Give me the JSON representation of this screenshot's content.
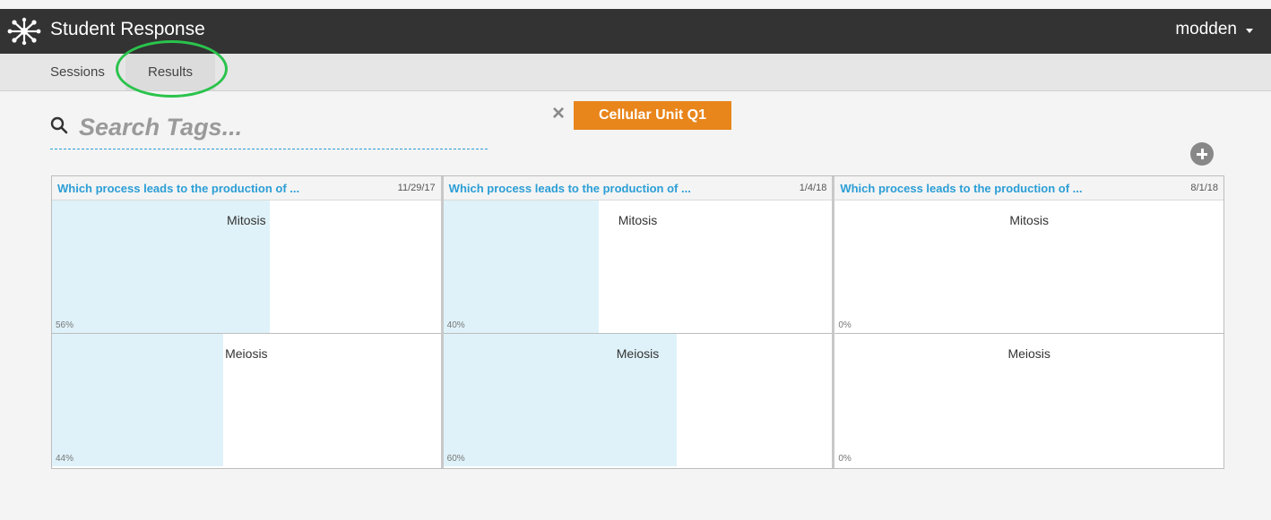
{
  "app": {
    "title": "Student Response",
    "user": "modden"
  },
  "nav": {
    "tabs": [
      {
        "label": "Sessions"
      },
      {
        "label": "Results",
        "active": true
      }
    ]
  },
  "search": {
    "placeholder": "Search Tags...",
    "value": ""
  },
  "active_tag": {
    "remove_glyph": "×",
    "label": "Cellular Unit Q1",
    "color": "#e8851b"
  },
  "colors": {
    "topbar": "#333333",
    "accent_link": "#2b9ed6",
    "bar_fill": "#dff2f9",
    "highlight_ring": "#2ac34c"
  },
  "results": [
    {
      "question": "Which process leads to the production of ...",
      "date": "11/29/17",
      "answers": [
        {
          "label": "Mitosis",
          "percent": 56,
          "percent_text": "56%"
        },
        {
          "label": "Meiosis",
          "percent": 44,
          "percent_text": "44%"
        }
      ]
    },
    {
      "question": "Which process leads to the production of ...",
      "date": "1/4/18",
      "answers": [
        {
          "label": "Mitosis",
          "percent": 40,
          "percent_text": "40%"
        },
        {
          "label": "Meiosis",
          "percent": 60,
          "percent_text": "60%"
        }
      ]
    },
    {
      "question": "Which process leads to the production of ...",
      "date": "8/1/18",
      "answers": [
        {
          "label": "Mitosis",
          "percent": 0,
          "percent_text": "0%"
        },
        {
          "label": "Meiosis",
          "percent": 0,
          "percent_text": "0%"
        }
      ]
    }
  ],
  "icons": [
    "network-logo-icon",
    "caret-down-icon",
    "search-icon",
    "close-icon",
    "plus-circle-icon"
  ]
}
